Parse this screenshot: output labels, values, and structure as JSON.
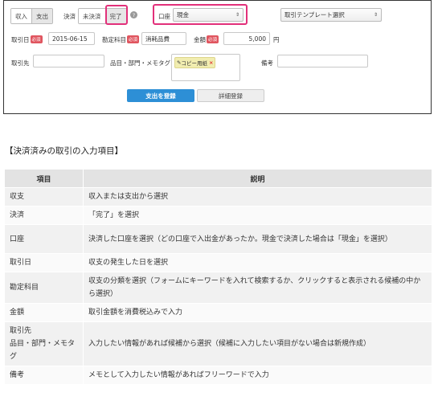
{
  "form": {
    "income_label": "収入",
    "expense_label": "支出",
    "settlement_label": "決済",
    "unsettled_label": "未決済",
    "settled_label": "完了",
    "help_icon_text": "?",
    "account_label": "口座",
    "account_value": "現金",
    "template_placeholder": "取引テンプレート選択",
    "date_label": "取引日",
    "required_badge": "必須",
    "date_value": "2015-06-15",
    "category_label": "勘定科目",
    "category_value": "消耗品費",
    "amount_label": "金額",
    "amount_value": "5,000",
    "currency_unit": "円",
    "partner_label": "取引先",
    "item_label": "品目・部門・メモタグ",
    "tag_value": "コピー用紙",
    "tag_remove": "×",
    "note_label": "備考",
    "submit_label": "支出を登録",
    "detail_label": "詳細登録"
  },
  "doc": {
    "heading": "【決済済みの取引の入力項目】",
    "columns": [
      "項目",
      "説明"
    ],
    "rows": [
      {
        "item": "収支",
        "desc": "収入または支出から選択"
      },
      {
        "item": "決済",
        "desc": "「完了」を選択"
      },
      {
        "item": "口座",
        "desc": "決済した口座を選択（どの口座で入出金があったか。現金で決済した場合は「現金」を選択）"
      },
      {
        "item": "取引日",
        "desc": "収支の発生した日を選択"
      },
      {
        "item": "勘定科目",
        "desc": "収支の分類を選択（フォームにキーワードを入れて検索するか、クリックすると表示される候補の中から選択）"
      },
      {
        "item": "金額",
        "desc": "取引金額を消費税込みで入力"
      },
      {
        "item": "取引先\n品目・部門・メモタグ",
        "desc": "入力したい情報があれば候補から選択（候補に入力したい項目がない場合は新規作成）"
      },
      {
        "item": "備考",
        "desc": "メモとして入力したい情報があればフリーワードで入力"
      }
    ]
  },
  "colors": {
    "highlight": "#e2307a",
    "primary": "#2d8fd6",
    "required": "#e0555f"
  }
}
